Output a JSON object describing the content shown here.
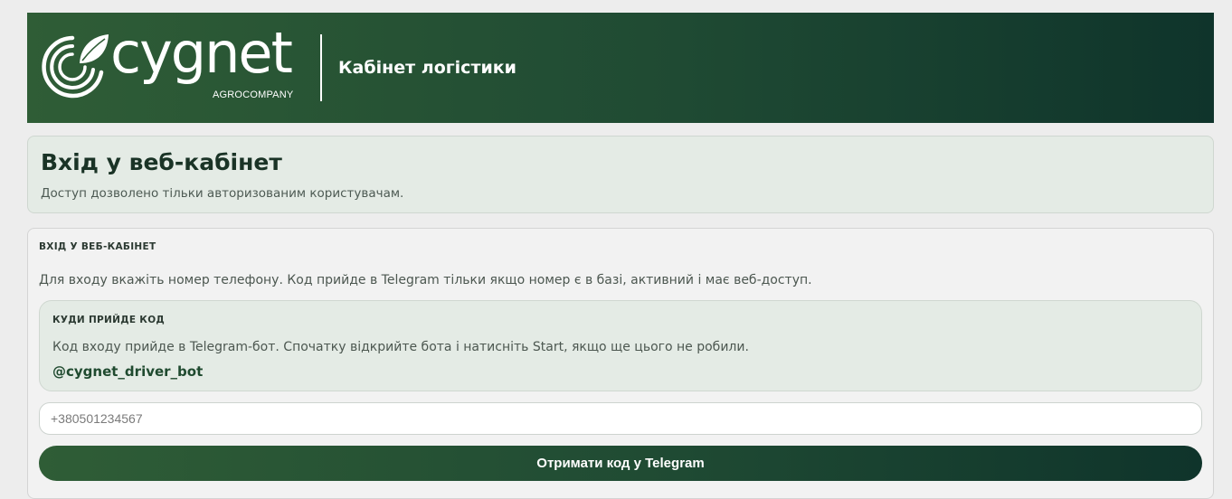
{
  "header": {
    "logo_word": "cygnet",
    "logo_sub": "AGROCOMPANY",
    "title": "Кабінет логістики"
  },
  "intro": {
    "title": "Вхід у веб-кабінет",
    "subtitle": "Доступ дозволено тільки авторизованим користувачам."
  },
  "login_card": {
    "title": "ВХІД У ВЕБ-КАБІНЕТ",
    "description": "Для входу вкажіть номер телефону. Код прийде в Telegram тільки якщо номер є в базі, активний і має веб-доступ.",
    "bot_box": {
      "title": "КУДИ ПРИЙДЕ КОД",
      "description": "Код входу прийде в Telegram-бот. Спочатку відкрийте бота і натисніть Start, якщо ще цього не робили.",
      "bot_name": "@cygnet_driver_bot"
    },
    "phone_input": {
      "value": "",
      "placeholder": "+380501234567"
    },
    "submit_label": "Отримати код у Telegram"
  },
  "colors": {
    "brand_dark": "#0f342b",
    "brand_green": "#2f5d36",
    "panel_bg": "#e4ebe5",
    "page_bg": "#ededed"
  }
}
